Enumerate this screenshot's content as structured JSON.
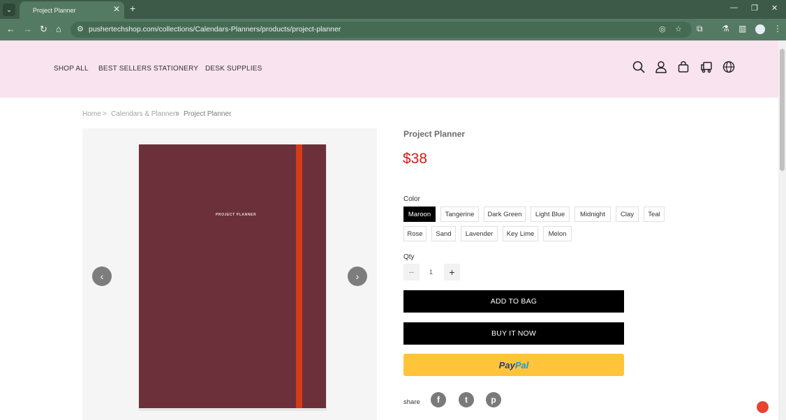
{
  "browser": {
    "tab_title": "Project Planner",
    "tab_close": "✕",
    "new_tab": "+",
    "url": "pushertechshop.com/collections/Calendars-Planners/products/project-planner"
  },
  "nav": {
    "items": [
      "SHOP ALL",
      "BEST SELLERS",
      "STATIONERY",
      "DESK SUPPLIES"
    ]
  },
  "breadcrumb": {
    "home": "Home",
    "sep": ">",
    "category": "Calendars & Planners",
    "current": "Project Planner"
  },
  "gallery": {
    "cover_text": "PROJECT PLANNER",
    "prev": "‹",
    "next": "›"
  },
  "product": {
    "title": "Project Planner",
    "price": "$38",
    "color_label": "Color",
    "colors": [
      "Maroon",
      "Tangerine",
      "Dark Green",
      "Light Blue",
      "Midnight",
      "Clay",
      "Teal",
      "Rose",
      "Sand",
      "Lavender",
      "Key Lime",
      "Melon"
    ],
    "selected_color": "Maroon",
    "qty_label": "Qty",
    "qty_minus": "−",
    "qty_value": "1",
    "qty_plus": "+",
    "add_to_bag": "ADD TO BAG",
    "buy_now": "BUY IT NOW",
    "paypal_a": "Pay",
    "paypal_b": "Pal",
    "share_label": "share"
  },
  "icons": {
    "header": [
      "search-icon",
      "account-icon",
      "bag-icon",
      "shipping-icon",
      "globe-icon"
    ],
    "social": [
      "facebook-icon",
      "twitter-icon",
      "pinterest-icon"
    ]
  },
  "colors": {
    "header_bg": "#f8e3ef",
    "price": "#d81818",
    "planner_cover": "#6b3039",
    "planner_band": "#d63a16",
    "paypal_yellow": "#ffc439",
    "chrome_green": "#557a63"
  }
}
